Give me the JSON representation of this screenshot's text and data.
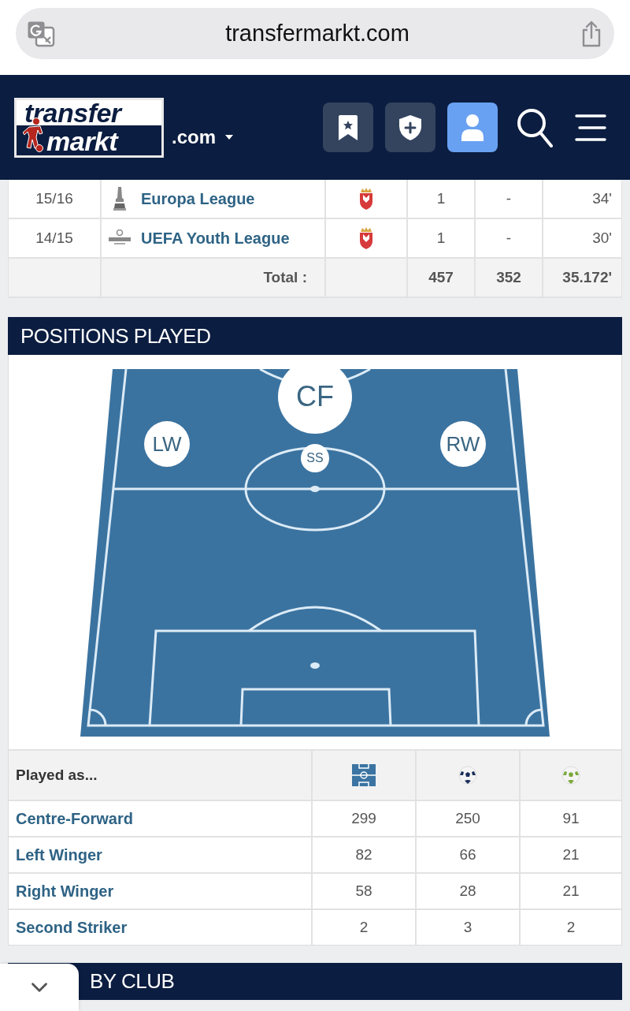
{
  "browser_bar": {
    "url": "transfermarkt.com"
  },
  "header": {
    "logo": {
      "line_1": "transfer",
      "line_2": "markt"
    },
    "domain": ".com",
    "toolbar": [
      {
        "active": false
      },
      {
        "active": false
      },
      {
        "active": true
      }
    ]
  },
  "competition_table": {
    "rows": [
      {
        "season": "15/16",
        "competition": "Europa League",
        "column_4": "1",
        "column_5": "-",
        "column_6": "34'"
      },
      {
        "season": "14/15",
        "competition": "UEFA Youth League",
        "column_4": "1",
        "column_5": "-",
        "column_6": "30'"
      }
    ],
    "total": {
      "label": "Total :",
      "column_4": "457",
      "column_5": "352",
      "column_6": "35.172'"
    }
  },
  "positions_played": {
    "title": "POSITIONS PLAYED",
    "pitch": {
      "markers": [
        {
          "label": "CF",
          "kind": "large"
        },
        {
          "label": "LW",
          "kind": "medium"
        },
        {
          "label": "RW",
          "kind": "medium"
        },
        {
          "label": "SS",
          "kind": "small"
        }
      ]
    },
    "table": {
      "header": "Played as...",
      "rows": [
        {
          "position": "Centre-Forward",
          "column_2": "299",
          "column_3": "250",
          "column_4": "91"
        },
        {
          "position": "Left Winger",
          "column_2": "82",
          "column_3": "66",
          "column_4": "21"
        },
        {
          "position": "Right Winger",
          "column_2": "58",
          "column_3": "28",
          "column_4": "21"
        },
        {
          "position": "Second Striker",
          "column_2": "2",
          "column_3": "3",
          "column_4": "2"
        }
      ]
    }
  },
  "next_section": {
    "title": "BY CLUB"
  }
}
